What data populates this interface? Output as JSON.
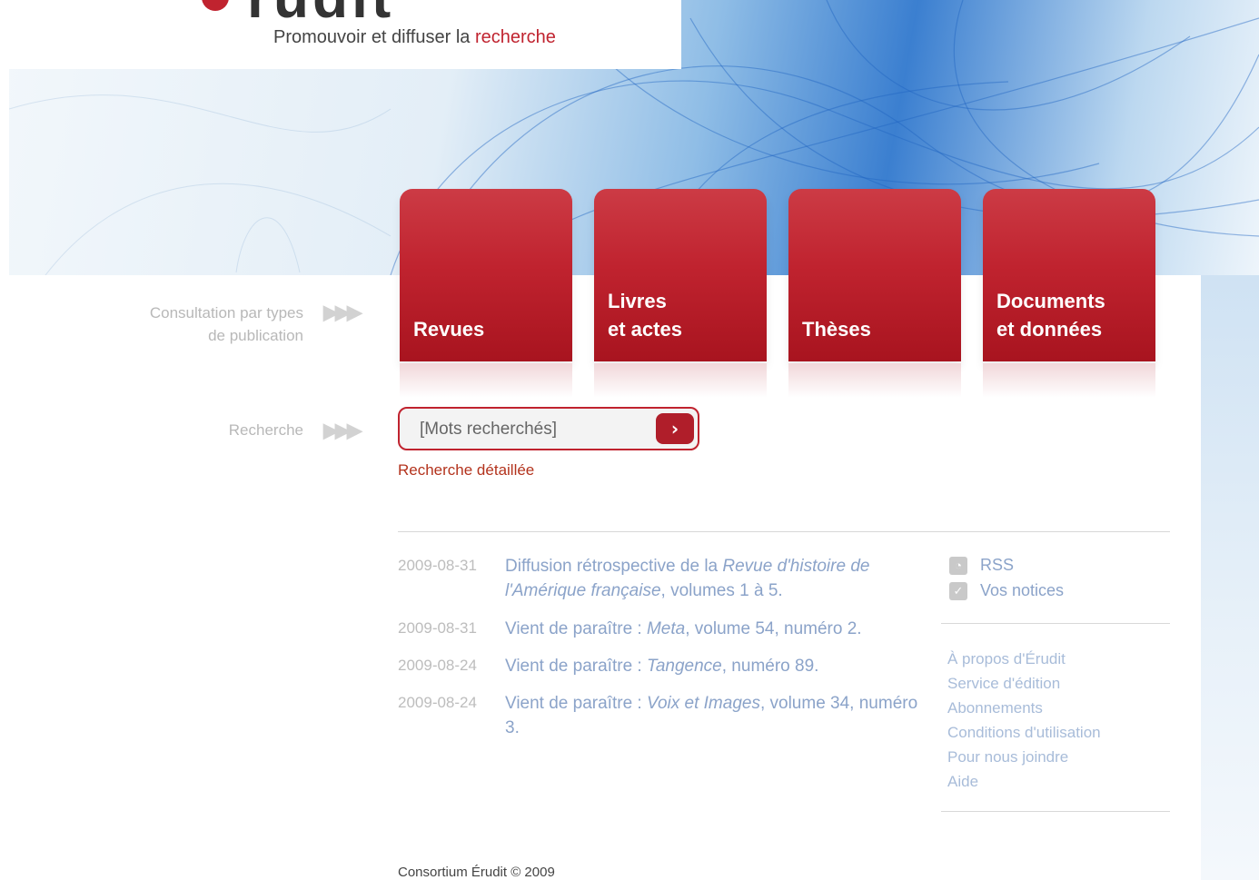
{
  "header": {
    "logo_word": "rudit",
    "tagline_main": "Promouvoir et diffuser la",
    "tagline_accent": "recherche"
  },
  "nav": {
    "section_label_1": "Consultation par types",
    "section_label_2": "de publication",
    "tabs": [
      {
        "label": "Revues"
      },
      {
        "label": "Livres\net actes"
      },
      {
        "label": "Thèses"
      },
      {
        "label": "Documents\net données"
      }
    ]
  },
  "search": {
    "section_label": "Recherche",
    "placeholder": "[Mots recherchés]",
    "button_glyph": "›",
    "advanced_link": "Recherche détaillée"
  },
  "news": [
    {
      "date": "2009-08-31",
      "prefix": "Diffusion rétrospective de la ",
      "title": "Revue d'histoire de l'Amérique française",
      "suffix": ", volumes 1 à 5."
    },
    {
      "date": "2009-08-31",
      "prefix": "Vient de paraître : ",
      "title": "Meta",
      "suffix": ", volume 54, numéro 2."
    },
    {
      "date": "2009-08-24",
      "prefix": "Vient de paraître : ",
      "title": "Tangence",
      "suffix": ", numéro 89."
    },
    {
      "date": "2009-08-24",
      "prefix": "Vient de paraître : ",
      "title": "Voix et Images",
      "suffix": ", volume 34, numéro 3."
    }
  ],
  "feeds": [
    {
      "label": "RSS",
      "icon": "rss-icon"
    },
    {
      "label": "Vos notices",
      "icon": "checkbox-icon"
    }
  ],
  "links": [
    "À propos d'Érudit",
    "Service d'édition",
    "Abonnements",
    "Conditions d'utilisation",
    "Pour nous joindre",
    "Aide"
  ],
  "footer": "Consortium Érudit ©  2009",
  "colors": {
    "brand_red": "#c0232f",
    "link_blue": "#8ba3c9"
  }
}
